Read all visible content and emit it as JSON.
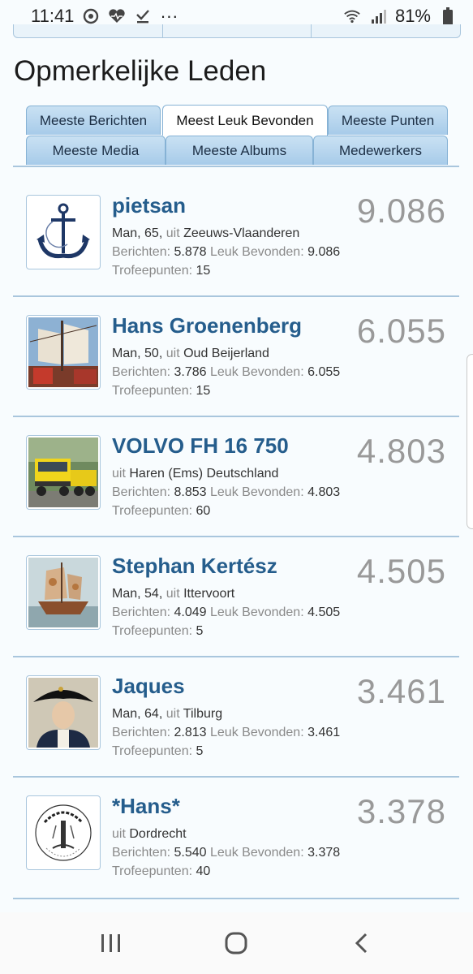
{
  "status_bar": {
    "time": "11:41",
    "dots": "···",
    "battery": "81%"
  },
  "page": {
    "title": "Opmerkelijke Leden"
  },
  "tabs": {
    "row1": [
      "Meeste Berichten",
      "Meest Leuk Bevonden",
      "Meeste Punten"
    ],
    "row2": [
      "Meeste Media",
      "Meeste Albums",
      "Medewerkers"
    ],
    "active": "Meest Leuk Bevonden"
  },
  "labels": {
    "man": "Man,",
    "uit": "uit",
    "berichten": "Berichten:",
    "leuk": "Leuk Bevonden:",
    "trofee": "Trofeepunten:"
  },
  "members": [
    {
      "name": "pietsan",
      "age": "65,",
      "location": "Zeeuws-Vlaanderen",
      "berichten": "5.878",
      "leuk": "9.086",
      "trofee": "15",
      "score": "9.086",
      "avatar": "anchor-icon"
    },
    {
      "name": "Hans Groenenberg",
      "age": "50,",
      "location": "Oud Beijerland",
      "berichten": "3.786",
      "leuk": "6.055",
      "trofee": "15",
      "score": "6.055",
      "avatar": "tall-ship-photo"
    },
    {
      "name": "VOLVO FH 16 750",
      "age": "",
      "location": "Haren (Ems) Deutschland",
      "berichten": "8.853",
      "leuk": "4.803",
      "trofee": "60",
      "score": "4.803",
      "avatar": "truck-photo"
    },
    {
      "name": "Stephan Kertész",
      "age": "54,",
      "location": "Ittervoort",
      "berichten": "4.049",
      "leuk": "4.505",
      "trofee": "5",
      "score": "4.505",
      "avatar": "ship-painting"
    },
    {
      "name": "Jaques",
      "age": "64,",
      "location": "Tilburg",
      "berichten": "2.813",
      "leuk": "3.461",
      "trofee": "5",
      "score": "3.461",
      "avatar": "admiral-portrait"
    },
    {
      "name": "*Hans*",
      "age": "",
      "location": "Dordrecht",
      "berichten": "5.540",
      "leuk": "3.378",
      "trofee": "40",
      "score": "3.378",
      "avatar": "kolderstok-seal"
    }
  ],
  "colors": {
    "accent_blue": "#255d8c",
    "tab_blue": "#a7cbe9",
    "border_blue": "#a9c6dd"
  }
}
